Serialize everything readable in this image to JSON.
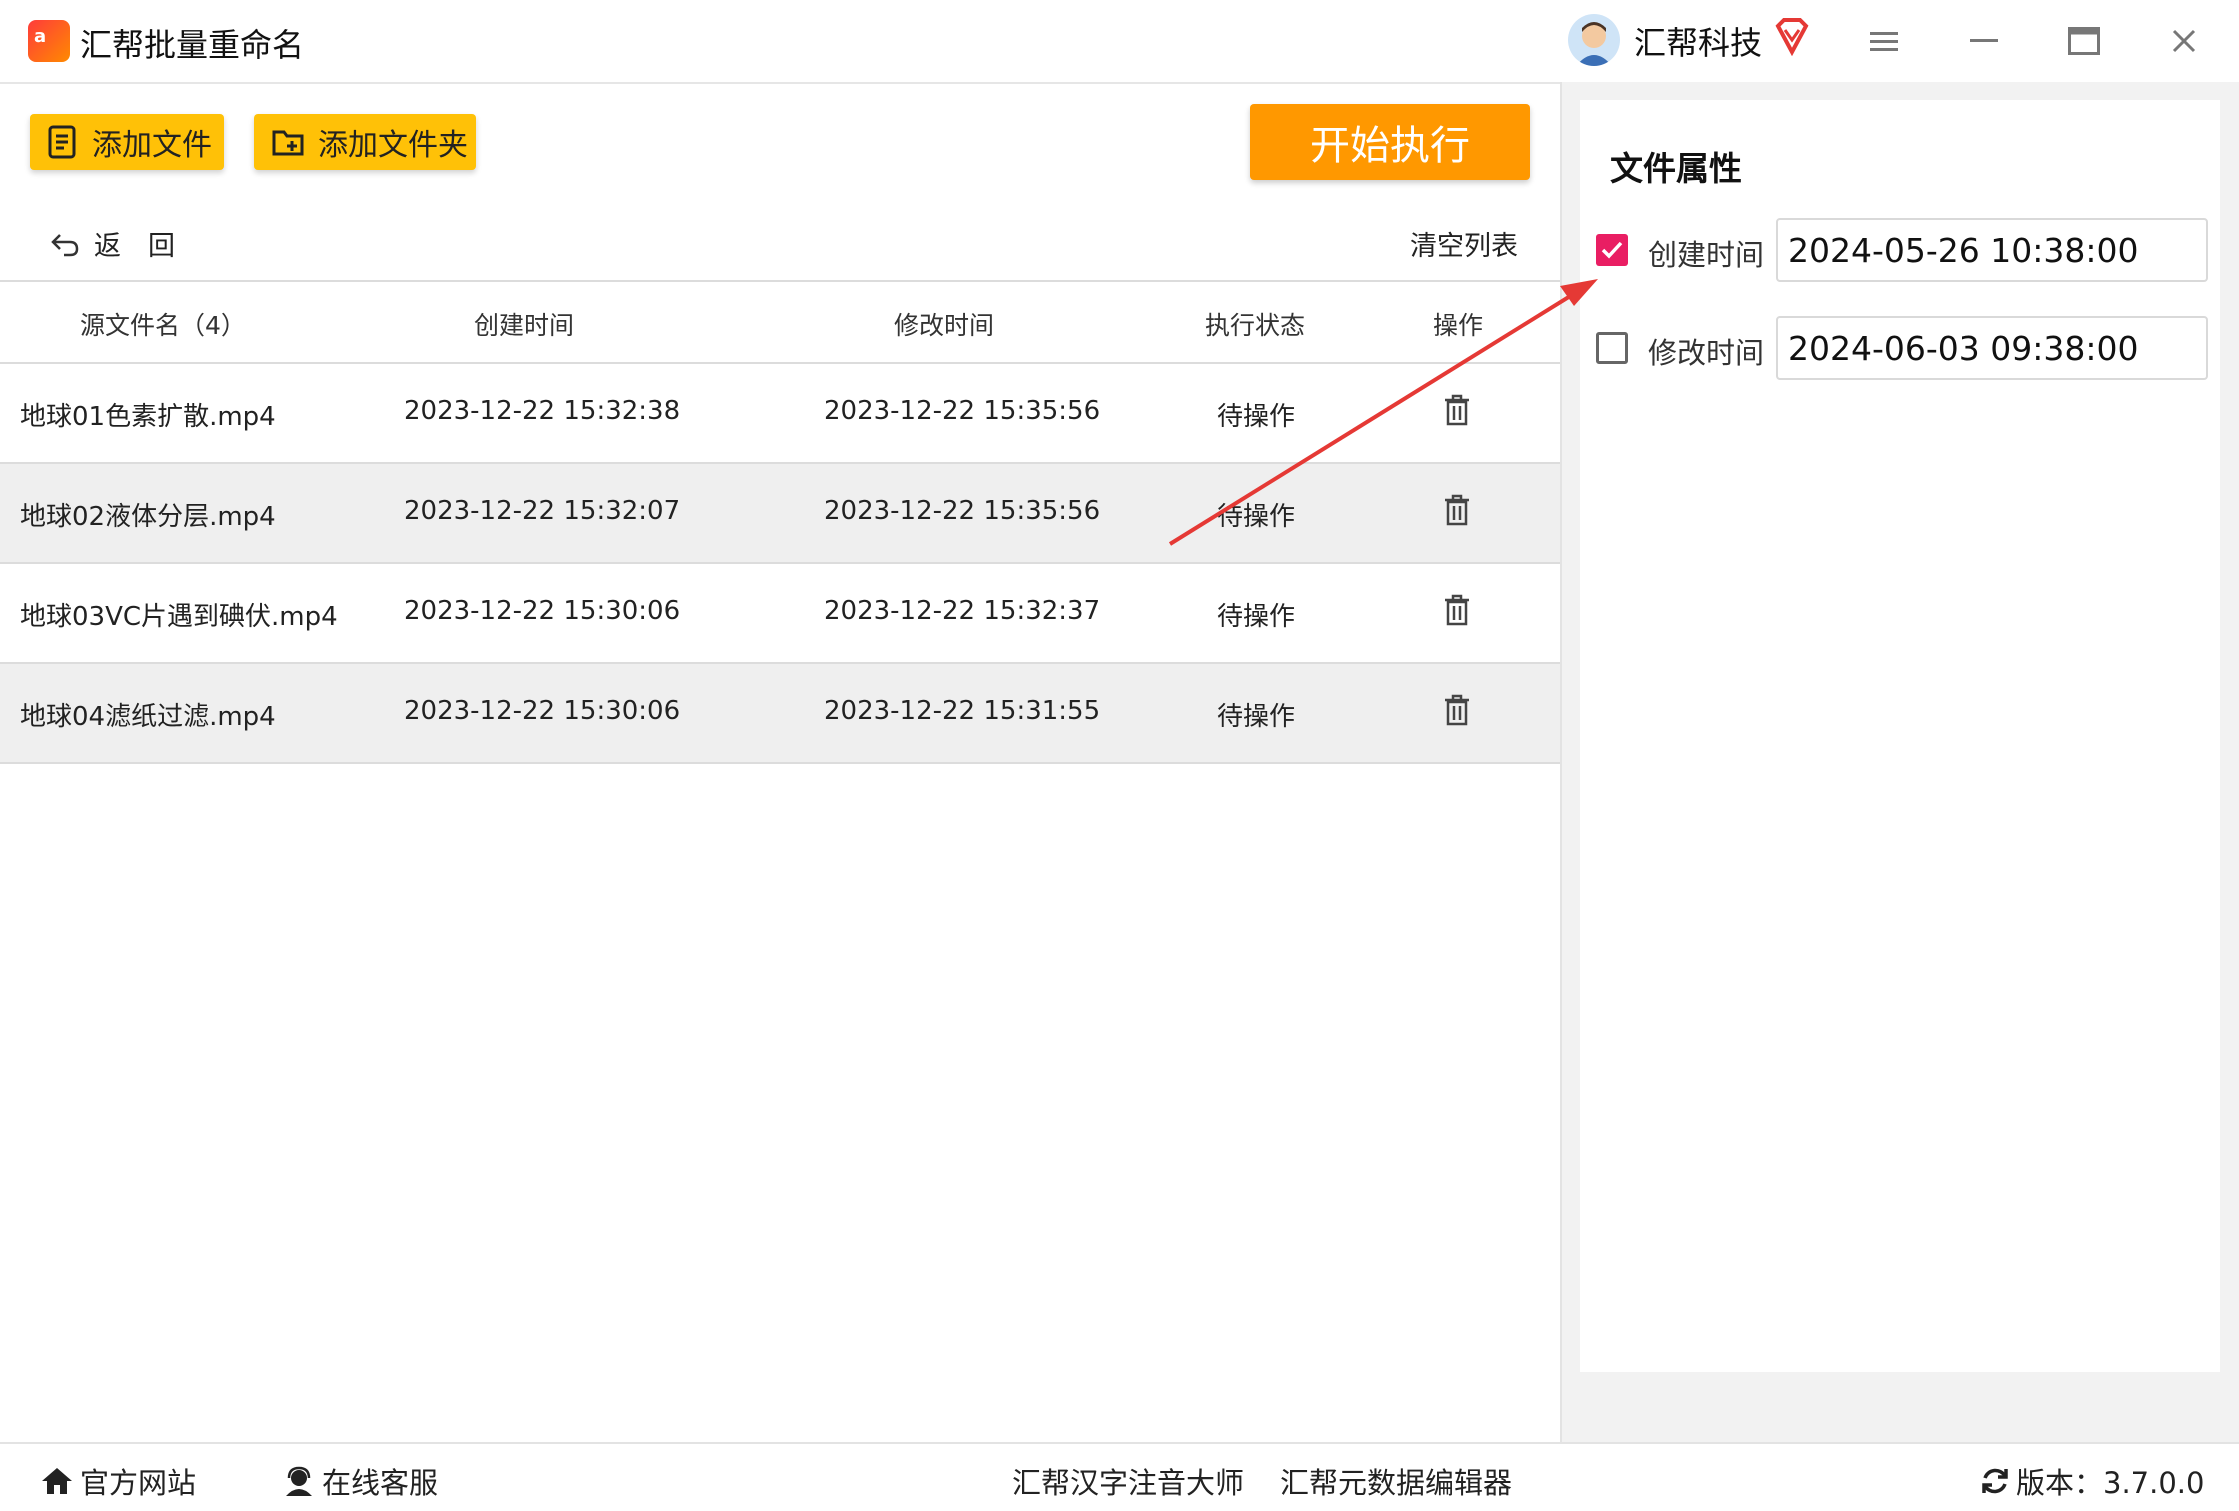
{
  "app": {
    "title": "汇帮批量重命名",
    "brand": "汇帮科技"
  },
  "toolbar": {
    "add_file_label": "添加文件",
    "add_folder_label": "添加文件夹",
    "start_label": "开始执行",
    "back_label": "返　回",
    "clear_label": "清空列表"
  },
  "table": {
    "headers": [
      "源文件名（4）",
      "创建时间",
      "修改时间",
      "执行状态",
      "操作"
    ],
    "rows": [
      {
        "name": "地球01色素扩散.mp4",
        "created": "2023-12-22 15:32:38",
        "modified": "2023-12-22 15:35:56",
        "status": "待操作"
      },
      {
        "name": "地球02液体分层.mp4",
        "created": "2023-12-22 15:32:07",
        "modified": "2023-12-22 15:35:56",
        "status": "待操作"
      },
      {
        "name": "地球03VC片遇到碘伏.mp4",
        "created": "2023-12-22 15:30:06",
        "modified": "2023-12-22 15:32:37",
        "status": "待操作"
      },
      {
        "name": "地球04滤纸过滤.mp4",
        "created": "2023-12-22 15:30:06",
        "modified": "2023-12-22 15:31:55",
        "status": "待操作"
      }
    ]
  },
  "properties": {
    "title": "文件属性",
    "created": {
      "label": "创建时间",
      "value": "2024-05-26 10:38:00",
      "checked": true
    },
    "modified": {
      "label": "修改时间",
      "value": "2024-06-03 09:38:00",
      "checked": false
    }
  },
  "bottom": {
    "website": "官方网站",
    "support": "在线客服",
    "pinyin_tool": "汇帮汉字注音大师",
    "metadata_tool": "汇帮元数据编辑器",
    "version": "版本：3.7.0.0"
  },
  "colors": {
    "accent_yellow": "#ffc107",
    "accent_orange": "#ff9800",
    "checkbox_pink": "#e91e63",
    "annotation_red": "#e53935"
  }
}
